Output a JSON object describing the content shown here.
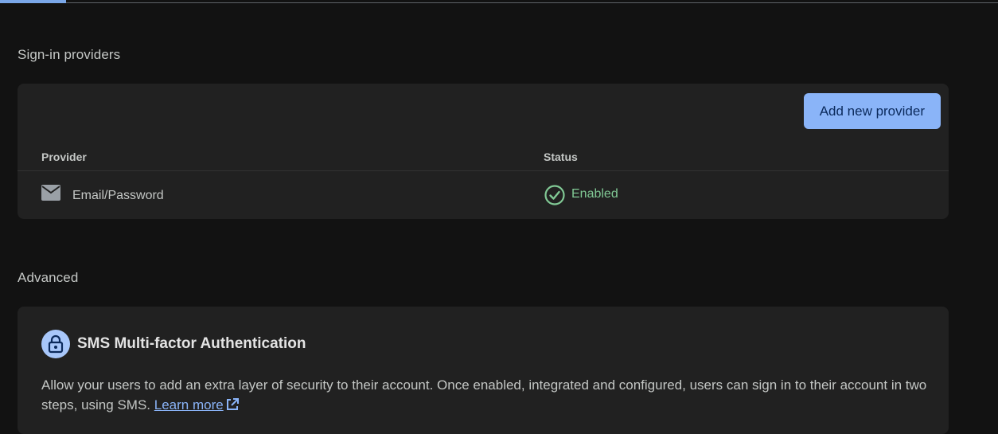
{
  "sign_in_providers": {
    "section_title": "Sign-in providers",
    "add_button_label": "Add new provider",
    "columns": {
      "provider": "Provider",
      "status": "Status"
    },
    "rows": [
      {
        "icon": "mail-icon",
        "provider": "Email/Password",
        "status_icon": "check-circle-icon",
        "status": "Enabled"
      }
    ]
  },
  "advanced": {
    "section_title": "Advanced",
    "sms_mfa": {
      "icon": "lock-icon",
      "title": "SMS Multi-factor Authentication",
      "description": "Allow your users to add an extra layer of security to their account. Once enabled, integrated and configured, users can sign in to their account in two steps, using SMS.",
      "learn_more_label": "Learn more",
      "learn_more_icon": "external-link-icon"
    }
  },
  "colors": {
    "background": "#121212",
    "card": "#212121",
    "accent": "#8ab4f8",
    "enabled": "#81c995"
  }
}
